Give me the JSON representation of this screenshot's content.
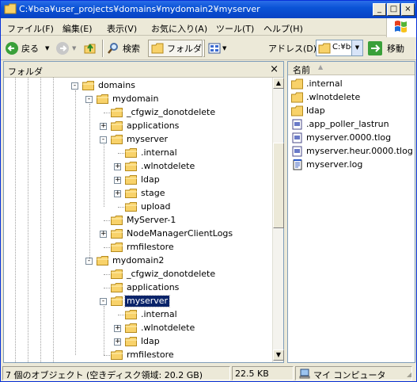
{
  "window": {
    "title": "C:¥bea¥user_projects¥domains¥mydomain2¥myserver"
  },
  "title_buttons": {
    "minimize": "_",
    "maximize": "□",
    "close": "×"
  },
  "menu": [
    "ファイル(F)",
    "編集(E)",
    "表示(V)",
    "お気に入り(A)",
    "ツール(T)",
    "ヘルプ(H)"
  ],
  "toolbar": {
    "back_label": "戻る",
    "search_label": "検索",
    "folders_label": "フォルダ",
    "address_label": "アドレス(D)",
    "address_value": "C:¥be",
    "go_label": "移動"
  },
  "left_pane": {
    "title": "フォルダ",
    "close": "×"
  },
  "tree": [
    {
      "label": "domains",
      "level": 0,
      "toggle": "-"
    },
    {
      "label": "mydomain",
      "level": 1,
      "toggle": "-"
    },
    {
      "label": "_cfgwiz_donotdelete",
      "level": 2,
      "toggle": ""
    },
    {
      "label": "applications",
      "level": 2,
      "toggle": "+"
    },
    {
      "label": "myserver",
      "level": 2,
      "toggle": "-"
    },
    {
      "label": ".internal",
      "level": 3,
      "toggle": ""
    },
    {
      "label": ".wlnotdelete",
      "level": 3,
      "toggle": "+"
    },
    {
      "label": "ldap",
      "level": 3,
      "toggle": "+"
    },
    {
      "label": "stage",
      "level": 3,
      "toggle": "+"
    },
    {
      "label": "upload",
      "level": 3,
      "toggle": ""
    },
    {
      "label": "MyServer-1",
      "level": 2,
      "toggle": ""
    },
    {
      "label": "NodeManagerClientLogs",
      "level": 2,
      "toggle": "+"
    },
    {
      "label": "rmfilestore",
      "level": 2,
      "toggle": ""
    },
    {
      "label": "mydomain2",
      "level": 1,
      "toggle": "-"
    },
    {
      "label": "_cfgwiz_donotdelete",
      "level": 2,
      "toggle": ""
    },
    {
      "label": "applications",
      "level": 2,
      "toggle": ""
    },
    {
      "label": "myserver",
      "level": 2,
      "toggle": "-",
      "selected": true
    },
    {
      "label": ".internal",
      "level": 3,
      "toggle": ""
    },
    {
      "label": ".wlnotdelete",
      "level": 3,
      "toggle": "+"
    },
    {
      "label": "ldap",
      "level": 3,
      "toggle": "+"
    },
    {
      "label": "rmfilestore",
      "level": 2,
      "toggle": ""
    }
  ],
  "right_pane": {
    "column_name": "名前",
    "sort_arrow": "▲",
    "files": [
      {
        "name": ".internal",
        "icon": "folder-icon"
      },
      {
        "name": ".wlnotdelete",
        "icon": "folder-icon"
      },
      {
        "name": "ldap",
        "icon": "folder-icon"
      },
      {
        "name": ".app_poller_lastrun",
        "icon": "file-icon"
      },
      {
        "name": "myserver.0000.tlog",
        "icon": "file-icon"
      },
      {
        "name": "myserver.heur.0000.tlog",
        "icon": "file-icon"
      },
      {
        "name": "myserver.log",
        "icon": "notepad-icon"
      }
    ]
  },
  "status": {
    "objects": "7 個のオブジェクト (空きディスク領域: 20.2 GB)",
    "size": "22.5 KB",
    "location": "マイ コンピュータ"
  },
  "scroll": {
    "up": "▲",
    "down": "▼"
  }
}
